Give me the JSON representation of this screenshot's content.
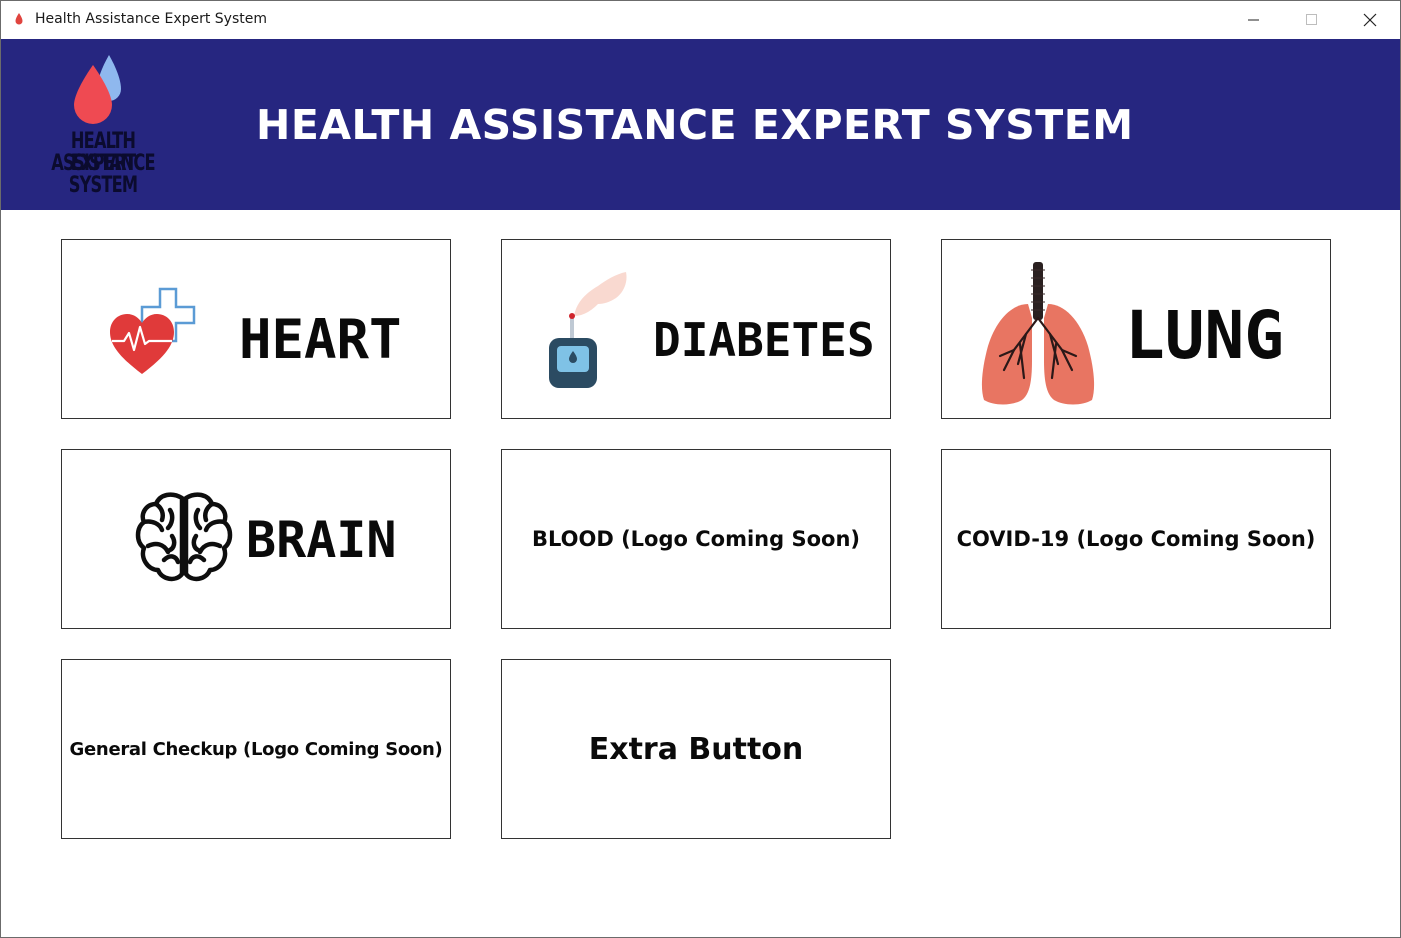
{
  "window": {
    "title": "Health Assistance Expert System"
  },
  "header": {
    "logo_line1": "HEALTH ASSISTANCE",
    "logo_line2": "EXPERT SYSTEM",
    "title": "HEALTH ASSISTANCE EXPERT SYSTEM",
    "background": "#262680"
  },
  "cards": {
    "heart": {
      "label": "HEART",
      "icon": "heart-cross-icon"
    },
    "diabetes": {
      "label": "DIABETES",
      "icon": "glucose-meter-icon"
    },
    "lung": {
      "label": "LUNG",
      "icon": "lungs-icon"
    },
    "brain": {
      "label": "BRAIN",
      "icon": "brain-icon"
    },
    "blood": {
      "label": "BLOOD (Logo Coming Soon)"
    },
    "covid": {
      "label": "COVID-19 (Logo Coming Soon)"
    },
    "general": {
      "label": "General Checkup (Logo Coming Soon)"
    },
    "extra": {
      "label": "Extra Button"
    }
  }
}
